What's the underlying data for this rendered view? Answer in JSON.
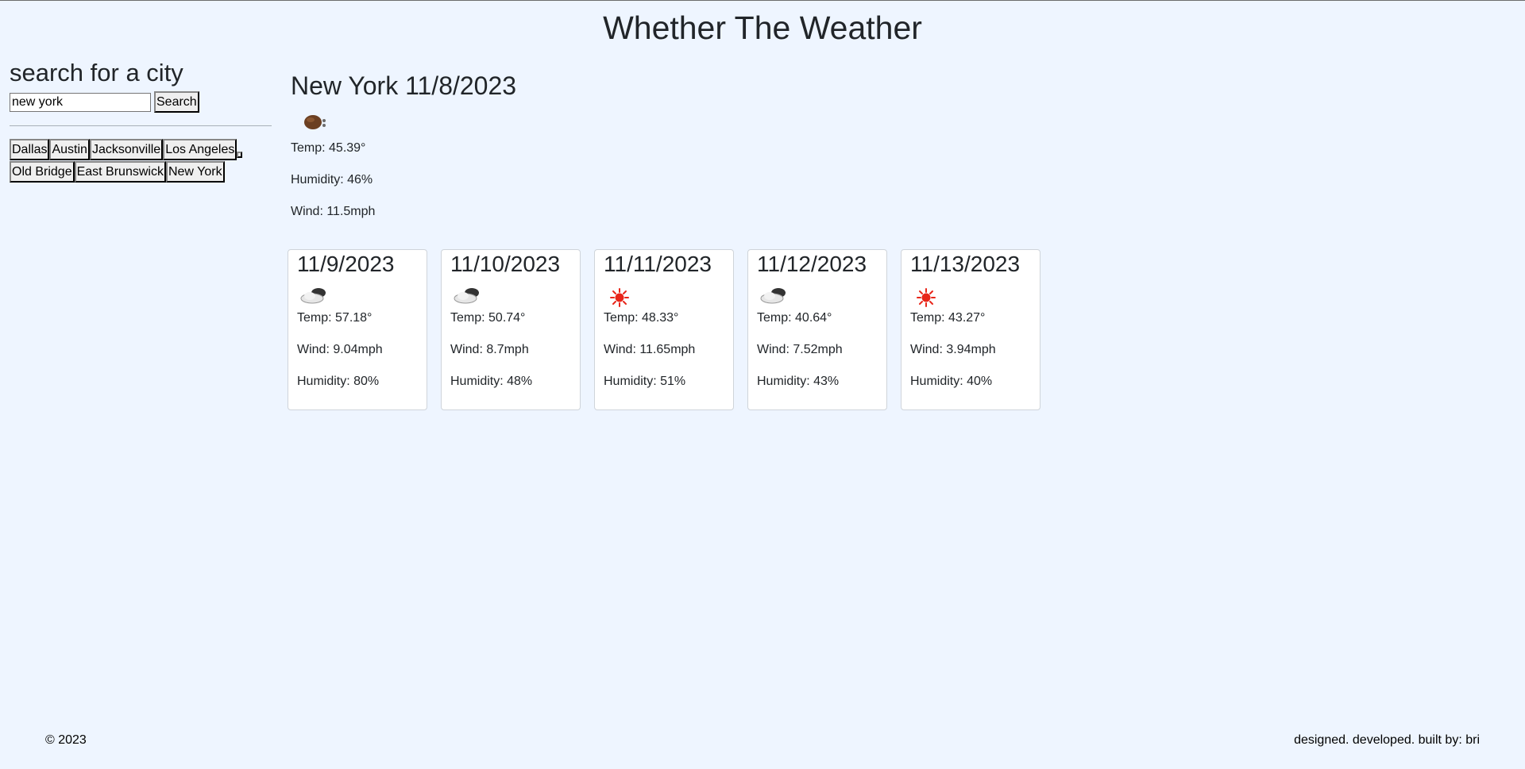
{
  "header": {
    "title": "Whether The Weather"
  },
  "sidebar": {
    "title": "search for a city",
    "search": {
      "value": "new york",
      "button_label": "Search"
    },
    "history": [
      "Dallas",
      "Austin",
      "Jacksonville",
      "Los Angeles",
      "",
      "Old Bridge",
      "East Brunswick",
      "New York"
    ]
  },
  "current": {
    "heading": "New York 11/8/2023",
    "icon": "night-partly-cloudy-icon",
    "temp": "Temp: 45.39°",
    "humidity": "Humidity: 46%",
    "wind": "Wind: 11.5mph"
  },
  "forecast": [
    {
      "date": "11/9/2023",
      "icon": "cloudy-icon",
      "temp": "Temp: 57.18°",
      "wind": "Wind: 9.04mph",
      "humidity": "Humidity: 80%"
    },
    {
      "date": "11/10/2023",
      "icon": "cloudy-icon",
      "temp": "Temp: 50.74°",
      "wind": "Wind: 8.7mph",
      "humidity": "Humidity: 48%"
    },
    {
      "date": "11/11/2023",
      "icon": "sun-icon",
      "temp": "Temp: 48.33°",
      "wind": "Wind: 11.65mph",
      "humidity": "Humidity: 51%"
    },
    {
      "date": "11/12/2023",
      "icon": "cloudy-icon",
      "temp": "Temp: 40.64°",
      "wind": "Wind: 7.52mph",
      "humidity": "Humidity: 43%"
    },
    {
      "date": "11/13/2023",
      "icon": "sun-icon",
      "temp": "Temp: 43.27°",
      "wind": "Wind: 3.94mph",
      "humidity": "Humidity: 40%"
    }
  ],
  "footer": {
    "copyright": "© 2023",
    "credit": "designed. developed. built by: bri"
  },
  "colors": {
    "background": "#eef5ff",
    "card": "#ffffff",
    "card_border": "#cfd4da",
    "text": "#212529",
    "sun": "#e8261a"
  }
}
